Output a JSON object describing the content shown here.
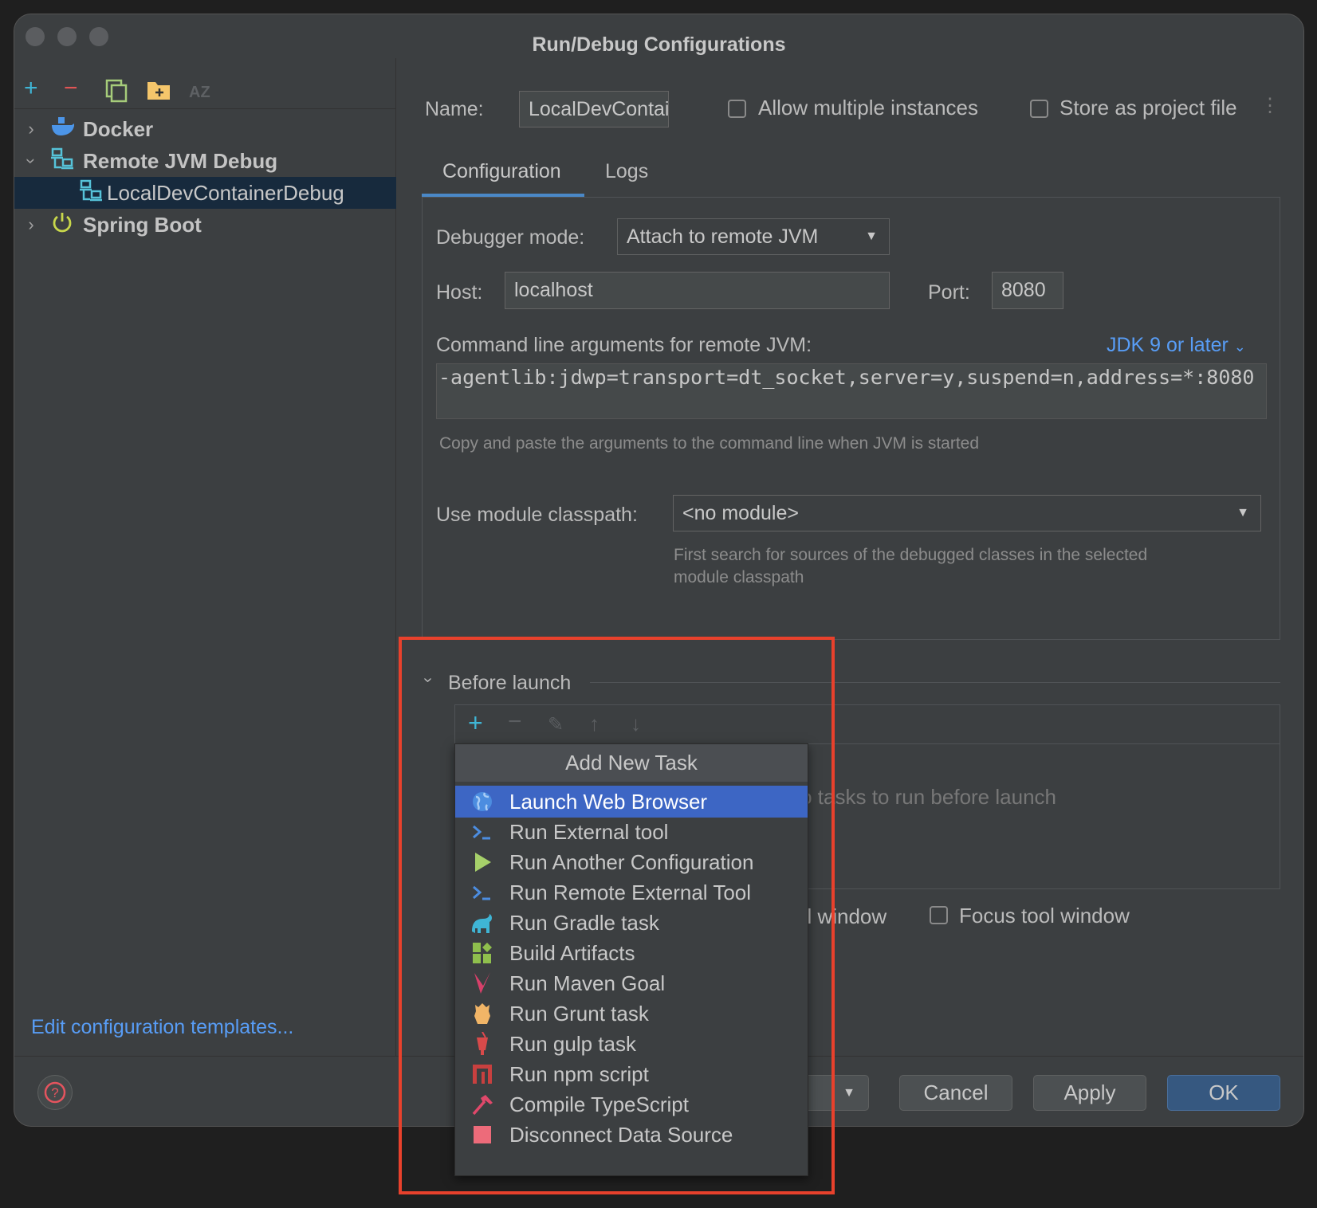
{
  "window": {
    "title": "Run/Debug Configurations"
  },
  "sidebar": {
    "toolbar": [
      "add-icon",
      "remove-icon",
      "copy-icon",
      "new-folder-icon",
      "sort-az-icon"
    ],
    "sort_label": "AZ",
    "tree": [
      {
        "label": "Docker",
        "expanded": false,
        "icon": "docker-icon"
      },
      {
        "label": "Remote JVM Debug",
        "expanded": true,
        "icon": "remote-debug-icon"
      },
      {
        "label": "LocalDevContainerDebug",
        "selected": true,
        "icon": "remote-debug-icon"
      },
      {
        "label": "Spring Boot",
        "expanded": false,
        "icon": "spring-boot-icon"
      }
    ],
    "edit_templates": "Edit configuration templates..."
  },
  "header": {
    "name_label": "Name:",
    "name_value": "LocalDevContainerDebug",
    "allow_multiple": "Allow multiple instances",
    "store_project": "Store as project file"
  },
  "tabs": [
    {
      "label": "Configuration",
      "active": true
    },
    {
      "label": "Logs"
    }
  ],
  "config": {
    "debugger_mode_label": "Debugger mode:",
    "debugger_mode": "Attach to remote JVM",
    "host_label": "Host:",
    "host": "localhost",
    "port_label": "Port:",
    "port": "8080",
    "cmd_label": "Command line arguments for remote JVM:",
    "jdk_link": "JDK 9 or later",
    "cmd_value": "-agentlib:jdwp=transport=dt_socket,server=y,suspend=n,address=*:8080",
    "cmd_hint": "Copy and paste the arguments to the command line when JVM is started",
    "module_label": "Use module classpath:",
    "module": "<no module>",
    "module_hint_1": "First search for sources of the debugged classes in the selected",
    "module_hint_2": "module classpath"
  },
  "before_launch": {
    "title": "Before launch",
    "empty_text": "There are no tasks to run before launch",
    "activate_partial": "ol window",
    "focus": "Focus tool window"
  },
  "menu": {
    "title": "Add New Task",
    "items": [
      {
        "label": "Launch Web Browser",
        "icon": "globe-icon"
      },
      {
        "label": "Run External tool",
        "icon": "terminal-icon"
      },
      {
        "label": "Run Another Configuration",
        "icon": "play-icon"
      },
      {
        "label": "Run Remote External Tool",
        "icon": "terminal-icon"
      },
      {
        "label": "Run Gradle task",
        "icon": "gradle-icon"
      },
      {
        "label": "Build Artifacts",
        "icon": "artifacts-icon"
      },
      {
        "label": "Run Maven Goal",
        "icon": "maven-icon"
      },
      {
        "label": "Run Grunt task",
        "icon": "grunt-icon"
      },
      {
        "label": "Run gulp task",
        "icon": "gulp-icon"
      },
      {
        "label": "Run npm script",
        "icon": "npm-icon"
      },
      {
        "label": "Compile TypeScript",
        "icon": "hammer-icon"
      },
      {
        "label": "Disconnect Data Source",
        "icon": "stop-icon"
      }
    ]
  },
  "buttons": {
    "cancel": "Cancel",
    "apply": "Apply",
    "ok": "OK"
  },
  "colors": {
    "accent": "#3d66c4",
    "link": "#589df6",
    "highlight_box": "#e8412c",
    "ok": "#365880"
  }
}
